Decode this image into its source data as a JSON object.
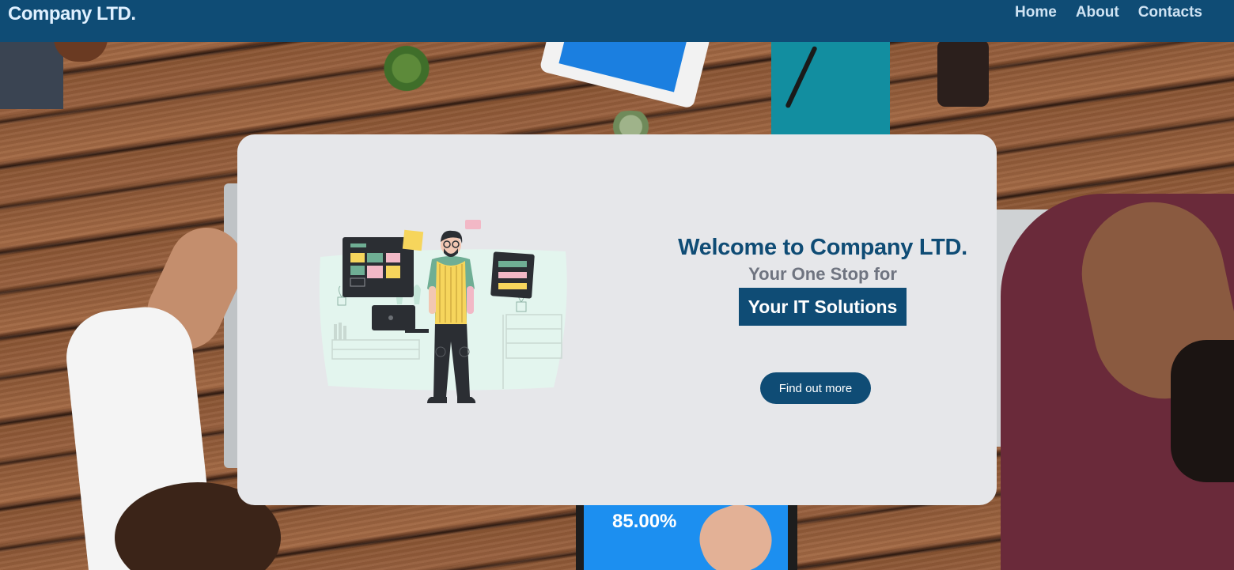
{
  "navbar": {
    "brand": "Company LTD.",
    "links": [
      {
        "label": "Home"
      },
      {
        "label": "About"
      },
      {
        "label": "Contacts"
      }
    ]
  },
  "hero": {
    "title": "Welcome to Company LTD.",
    "subtitle": "Your One Stop for",
    "highlight": "Your IT Solutions",
    "cta_label": "Find out more"
  },
  "background": {
    "tablet_stat": "85.00%"
  },
  "colors": {
    "primary": "#0f4c75",
    "card": "#e6e7ea",
    "subtitle": "#6f7480",
    "accent_yellow": "#f6d55c",
    "accent_green": "#6fae94",
    "accent_pink": "#f2b8c6"
  }
}
